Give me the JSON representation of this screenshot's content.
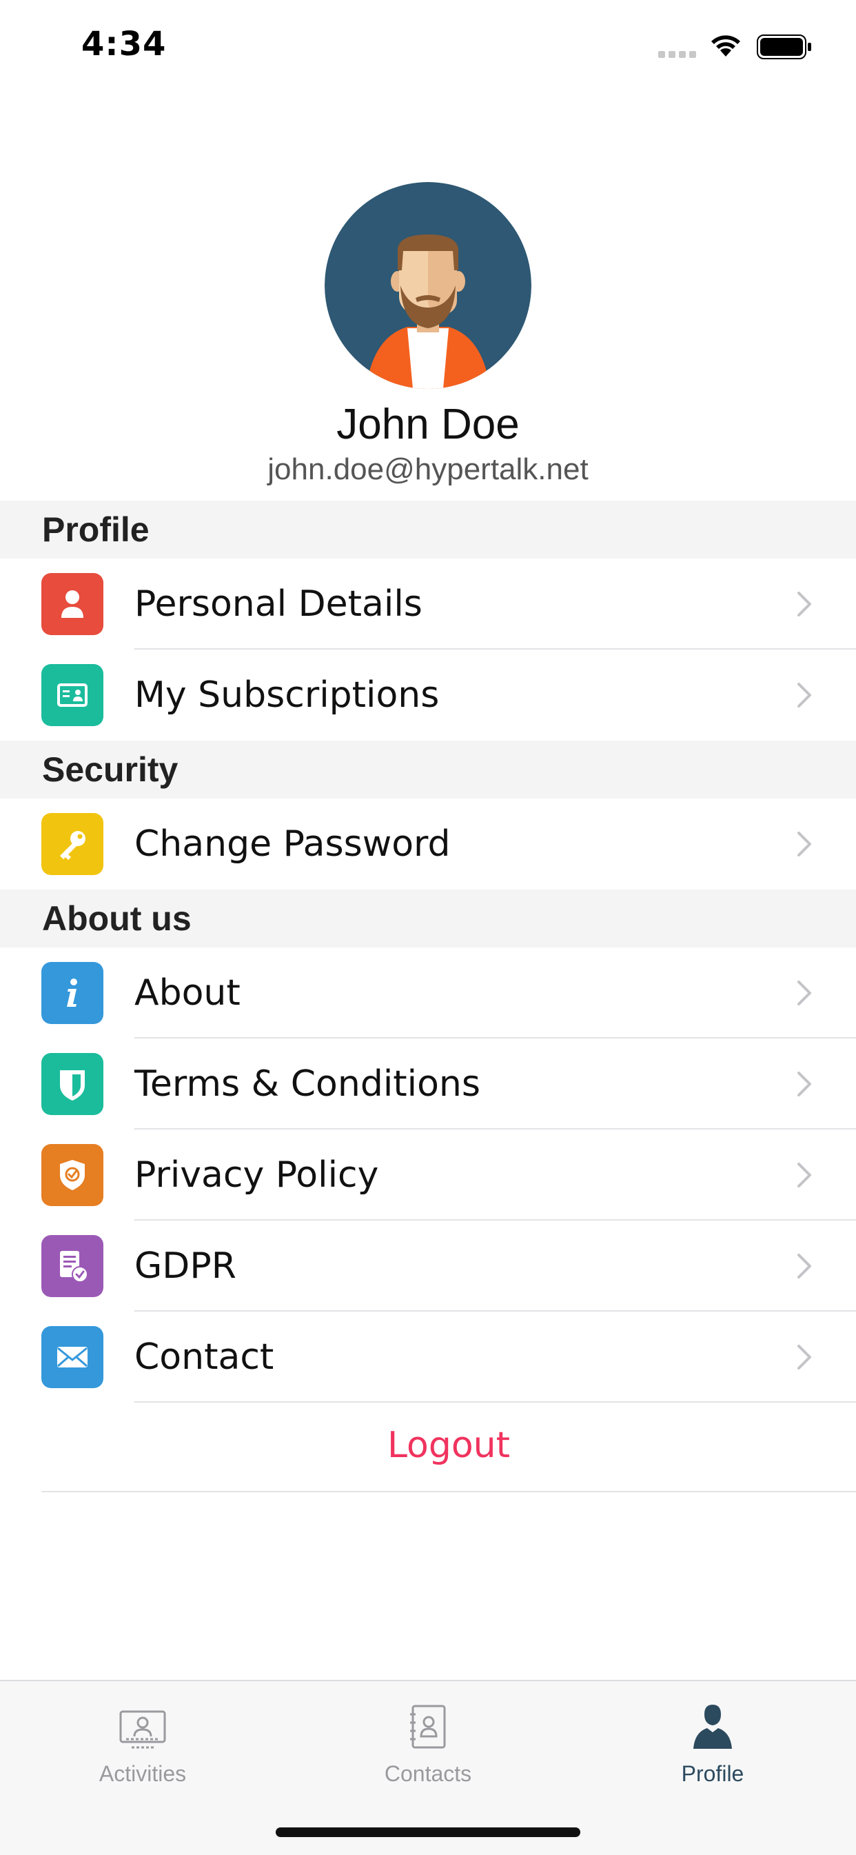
{
  "status_bar": {
    "time": "4:34"
  },
  "user": {
    "name": "John Doe",
    "email": "john.doe@hypertalk.net"
  },
  "sections": [
    {
      "title": "Profile",
      "items": [
        {
          "label": "Personal Details",
          "icon": "person-icon",
          "color": "#e74c3c"
        },
        {
          "label": "My Subscriptions",
          "icon": "id-card-icon",
          "color": "#1abc9c"
        }
      ]
    },
    {
      "title": "Security",
      "items": [
        {
          "label": "Change Password",
          "icon": "key-icon",
          "color": "#f1c40f"
        }
      ]
    },
    {
      "title": "About us",
      "items": [
        {
          "label": "About",
          "icon": "info-icon",
          "color": "#3498db"
        },
        {
          "label": "Terms & Conditions",
          "icon": "shield-icon",
          "color": "#1abc9c"
        },
        {
          "label": "Privacy Policy",
          "icon": "privacy-shield-icon",
          "color": "#e67e22"
        },
        {
          "label": "GDPR",
          "icon": "document-check-icon",
          "color": "#9b59b6"
        },
        {
          "label": "Contact",
          "icon": "envelope-icon",
          "color": "#3498db"
        }
      ]
    }
  ],
  "logout_label": "Logout",
  "logout_color": "#f0335e",
  "tabs": [
    {
      "label": "Activities",
      "icon": "monitor-user-icon",
      "active": false
    },
    {
      "label": "Contacts",
      "icon": "address-book-icon",
      "active": false
    },
    {
      "label": "Profile",
      "icon": "person-silhouette-icon",
      "active": true
    }
  ]
}
